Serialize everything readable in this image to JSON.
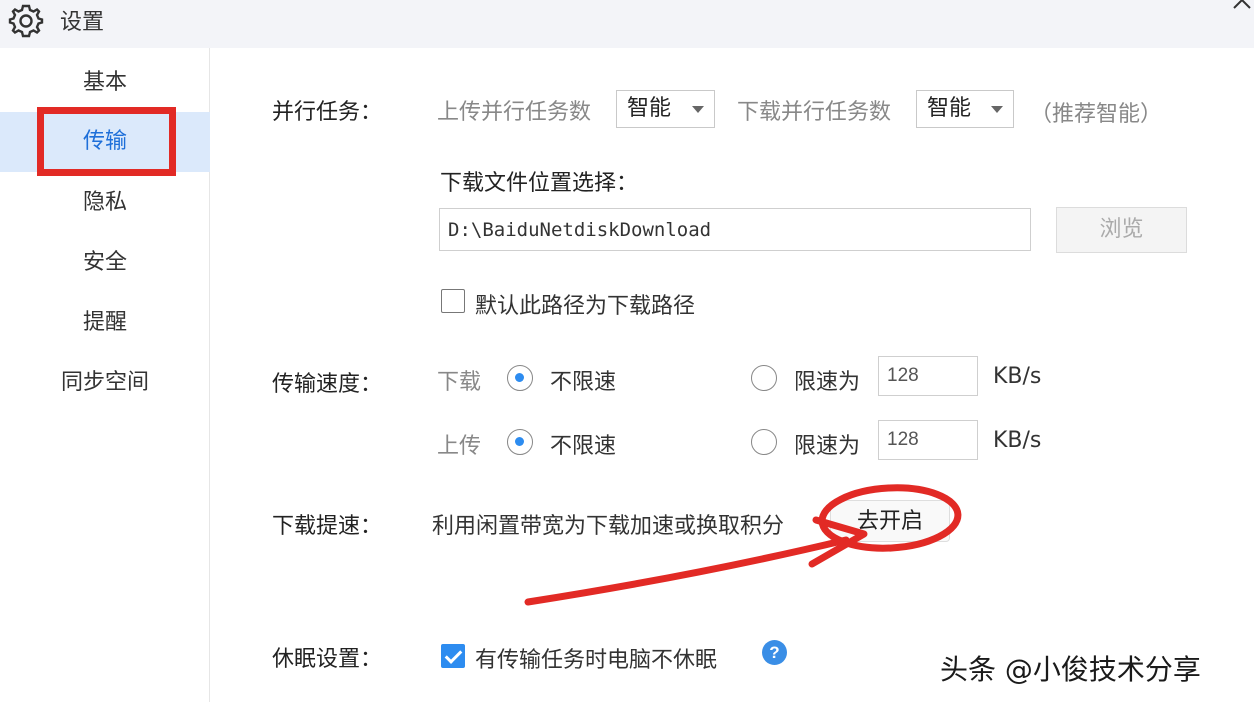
{
  "window": {
    "title": "设置"
  },
  "sidebar": {
    "items": [
      {
        "label": "基本"
      },
      {
        "label": "传输",
        "active": true
      },
      {
        "label": "隐私"
      },
      {
        "label": "安全"
      },
      {
        "label": "提醒"
      },
      {
        "label": "同步空间"
      }
    ]
  },
  "parallel": {
    "label": "并行任务：",
    "upload_label": "上传并行任务数",
    "upload_value": "智能",
    "download_label": "下载并行任务数",
    "download_value": "智能",
    "hint": "（推荐智能）"
  },
  "download_location": {
    "label": "下载文件位置选择：",
    "path": "D:\\BaiduNetdiskDownload",
    "browse": "浏览",
    "default_checkbox": "默认此路径为下载路径",
    "default_checked": false
  },
  "speed": {
    "label": "传输速度：",
    "download": {
      "label": "下载",
      "unlimited": "不限速",
      "limit_label": "限速为",
      "limit_value": "128",
      "unit": "KB/s"
    },
    "upload": {
      "label": "上传",
      "unlimited": "不限速",
      "limit_label": "限速为",
      "limit_value": "128",
      "unit": "KB/s"
    }
  },
  "boost": {
    "label": "下载提速：",
    "desc": "利用闲置带宽为下载加速或换取积分",
    "button": "去开启"
  },
  "sleep": {
    "label": "休眠设置：",
    "checkbox": "有传输任务时电脑不休眠",
    "checked": true,
    "help_glyph": "?"
  },
  "watermark": "头条 @小俊技术分享",
  "colors": {
    "accent": "#2d8cf0",
    "annotation": "#e22a25",
    "active_bg": "#dbe9fb"
  }
}
